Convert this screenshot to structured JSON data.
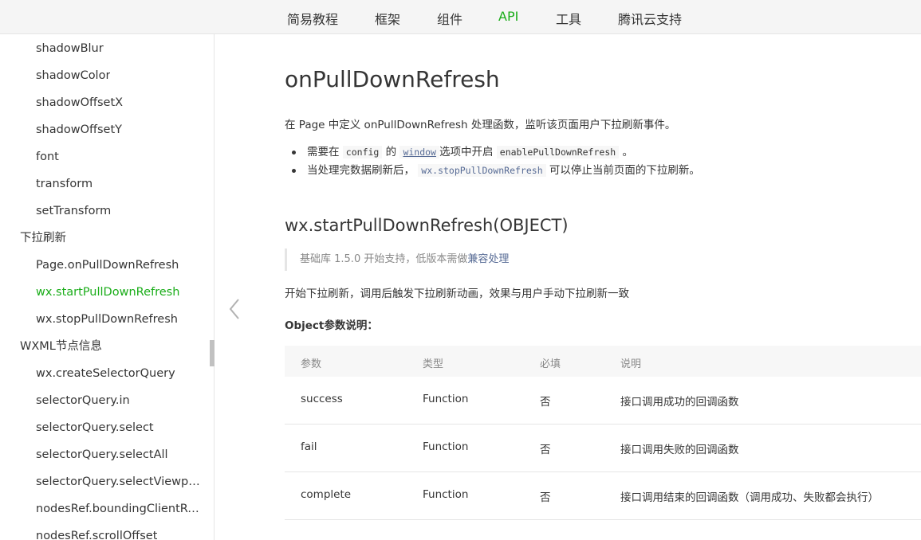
{
  "topnav": {
    "items": [
      "简易教程",
      "框架",
      "组件",
      "API",
      "工具",
      "腾讯云支持"
    ],
    "active_index": 3
  },
  "sidebar": {
    "items": [
      {
        "label": "shadowBlur",
        "level": 2
      },
      {
        "label": "shadowColor",
        "level": 2
      },
      {
        "label": "shadowOffsetX",
        "level": 2
      },
      {
        "label": "shadowOffsetY",
        "level": 2
      },
      {
        "label": "font",
        "level": 2
      },
      {
        "label": "transform",
        "level": 2
      },
      {
        "label": "setTransform",
        "level": 2
      },
      {
        "label": "下拉刷新",
        "level": 1
      },
      {
        "label": "Page.onPullDownRefresh",
        "level": 2
      },
      {
        "label": "wx.startPullDownRefresh",
        "level": 2,
        "active": true
      },
      {
        "label": "wx.stopPullDownRefresh",
        "level": 2
      },
      {
        "label": "WXML节点信息",
        "level": 1
      },
      {
        "label": "wx.createSelectorQuery",
        "level": 2
      },
      {
        "label": "selectorQuery.in",
        "level": 2
      },
      {
        "label": "selectorQuery.select",
        "level": 2
      },
      {
        "label": "selectorQuery.selectAll",
        "level": 2
      },
      {
        "label": "selectorQuery.selectViewport",
        "level": 2
      },
      {
        "label": "nodesRef.boundingClientRect",
        "level": 2
      },
      {
        "label": "nodesRef.scrollOffset",
        "level": 2
      }
    ]
  },
  "main": {
    "title": "onPullDownRefresh",
    "intro": "在 Page 中定义 onPullDownRefresh 处理函数，监听该页面用户下拉刷新事件。",
    "bullet1": {
      "pre": "需要在",
      "code1": "config",
      "mid": "的",
      "link": "window",
      "post": "选项中开启",
      "code2": "enablePullDownRefresh",
      "end": "。"
    },
    "bullet2": {
      "pre": "当处理完数据刷新后，",
      "code": "wx.stopPullDownRefresh",
      "post": "可以停止当前页面的下拉刷新。"
    },
    "h2": "wx.startPullDownRefresh(OBJECT)",
    "quote": {
      "text": "基础库 1.5.0 开始支持，低版本需做",
      "link": "兼容处理"
    },
    "para": "开始下拉刷新，调用后触发下拉刷新动画，效果与用户手动下拉刷新一致",
    "object_label": "Object参数说明：",
    "table": {
      "headers": [
        "参数",
        "类型",
        "必填",
        "说明"
      ],
      "rows": [
        [
          "success",
          "Function",
          "否",
          "接口调用成功的回调函数"
        ],
        [
          "fail",
          "Function",
          "否",
          "接口调用失败的回调函数"
        ],
        [
          "complete",
          "Function",
          "否",
          "接口调用结束的回调函数（调用成功、失败都会执行）"
        ]
      ]
    }
  },
  "colors": {
    "accent": "#1aad19",
    "link": "#576b95",
    "text": "#353535",
    "muted": "#888888"
  }
}
